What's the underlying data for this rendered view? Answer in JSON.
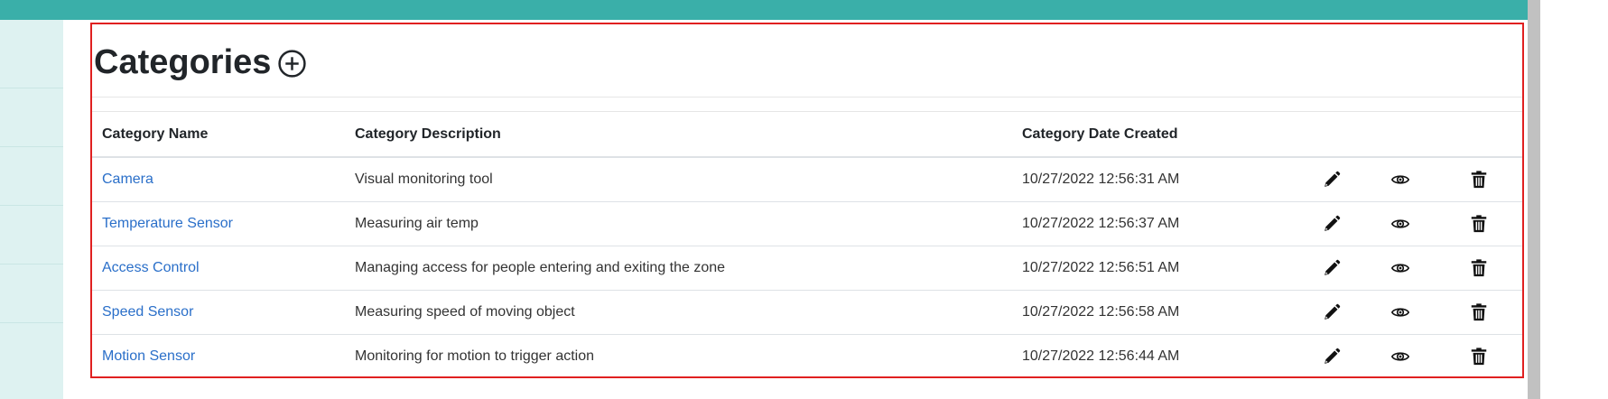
{
  "page": {
    "title": "Categories"
  },
  "icons": {
    "add": "add-circle-icon",
    "edit": "pencil-icon",
    "view": "eye-icon",
    "delete": "trash-icon"
  },
  "colors": {
    "topbar": "#3aafa9",
    "sidebar": "#def2f1",
    "link": "#2a6fc9",
    "highlight_border": "#e02020"
  },
  "table": {
    "headers": {
      "name": "Category Name",
      "description": "Category Description",
      "date": "Category Date Created"
    },
    "rows": [
      {
        "name": "Camera",
        "description": "Visual monitoring tool",
        "date": "10/27/2022 12:56:31 AM"
      },
      {
        "name": "Temperature Sensor",
        "description": "Measuring air temp",
        "date": "10/27/2022 12:56:37 AM"
      },
      {
        "name": "Access Control",
        "description": "Managing access for people entering and exiting the zone",
        "date": "10/27/2022 12:56:51 AM"
      },
      {
        "name": "Speed Sensor",
        "description": "Measuring speed of moving object",
        "date": "10/27/2022 12:56:58 AM"
      },
      {
        "name": "Motion Sensor",
        "description": "Monitoring for motion to trigger action",
        "date": "10/27/2022 12:56:44 AM"
      }
    ]
  }
}
